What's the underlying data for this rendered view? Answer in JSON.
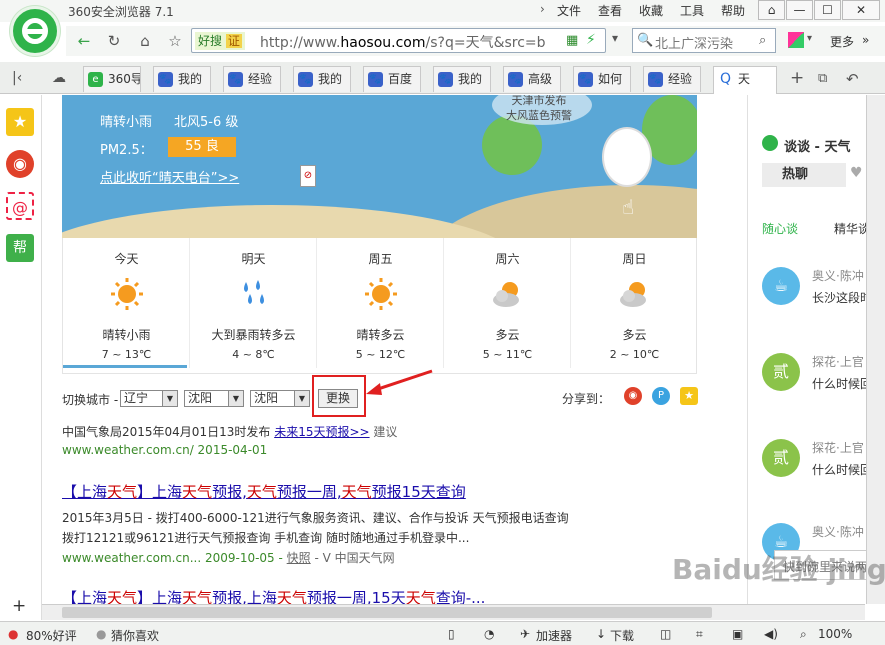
{
  "window": {
    "app_title": "360安全浏览器 7.1",
    "menu": [
      "文件",
      "查看",
      "收藏",
      "工具",
      "帮助"
    ],
    "controls": [
      "⌂",
      "—",
      "☐",
      "✕"
    ]
  },
  "address_bar": {
    "haosou_label": "好搜",
    "cert_label": "证",
    "url_prefix": "http://www.",
    "url_domain": "haosou.com",
    "url_rest": "/s?q=天气&src=b",
    "search_text": "北上广深污染",
    "more_label": "更多"
  },
  "tabs": [
    {
      "label": "360导"
    },
    {
      "label": "我的"
    },
    {
      "label": "经验"
    },
    {
      "label": "我的"
    },
    {
      "label": "百度"
    },
    {
      "label": "我的"
    },
    {
      "label": "高级"
    },
    {
      "label": "如何"
    },
    {
      "label": "经验"
    },
    {
      "label": "天"
    }
  ],
  "weather": {
    "condition_now": "晴转小雨",
    "wind": "北风5-6 级",
    "pm25_label": "PM2.5：",
    "pm25_value": "55 良",
    "radio_link": "点此收听“晴天电台”>>",
    "bubble_line1": "天津市发布",
    "bubble_line2": "大风蓝色预警",
    "days": [
      {
        "name": "今天",
        "icon": "sun-icon",
        "desc": "晴转小雨",
        "temp": "7 ~ 13℃"
      },
      {
        "name": "明天",
        "icon": "rain-icon",
        "desc": "大到暴雨转多云",
        "temp": "4 ~ 8℃"
      },
      {
        "name": "周五",
        "icon": "sun-icon",
        "desc": "晴转多云",
        "temp": "5 ~ 12℃"
      },
      {
        "name": "周六",
        "icon": "cloudy-icon",
        "desc": "多云",
        "temp": "5 ~ 11℃"
      },
      {
        "name": "周日",
        "icon": "cloudy-icon",
        "desc": "多云",
        "temp": "2 ~ 10℃"
      }
    ],
    "switch_city_label": "切换城市 -",
    "province": "辽宁",
    "city": "沈阳",
    "district": "沈阳",
    "change_button": "更换",
    "share_label": "分享到：",
    "source_prefix": "中国气象局2015年04月01日13时发布",
    "forecast_link": "未来15天预报>>",
    "suggest_link": "建议",
    "source_url": "www.weather.com.cn/ 2015-04-01"
  },
  "results": [
    {
      "title_parts": [
        "【上海",
        "天气",
        "】上海",
        "天气",
        "预报,",
        "天气",
        "预报一周,",
        "天气",
        "预报15天查询"
      ],
      "snippet1": "2015年3月5日 - 拨打400-6000-121进行气象服务资讯、建议、合作与投诉 天气预报电话查询",
      "snippet2": "拨打12121或96121进行天气预报查询 手机查询 随时随地通过手机登录中...",
      "url": "www.weather.com.cn... 2009-10-05 -",
      "snapshot": "快照",
      "verified": "- V 中国天气网"
    },
    {
      "title_parts": [
        "【上海",
        "天气",
        "】上海",
        "天气",
        "预报,上海",
        "天气",
        "预报一周,15天",
        "天气",
        "查询-..."
      ]
    }
  ],
  "right_panel": {
    "talk_label": "谈谈 - 天气",
    "hot_tab": "热聊",
    "tab_a": "随心谈",
    "tab_b": "精华谈",
    "posts": [
      {
        "user": "奥义·陈冲",
        "text": "长沙这段时"
      },
      {
        "user": "探花·上官",
        "text": "什么时候回"
      },
      {
        "user": "探花·上官",
        "text": "什么时候回"
      },
      {
        "user": "奥义·陈冲",
        "text": ""
      }
    ],
    "quick_comment": "快到碗里来说两"
  },
  "status": {
    "rating": "80%好评",
    "guess": "猜你喜欢",
    "accelerator": "加速器",
    "download": "下载",
    "zoom": "100%"
  },
  "watermark": "Baidu经验 jingyan.baidu.com",
  "colors": {
    "brand_green": "#2fb34a",
    "sky_blue": "#5aa7d6",
    "pm_badge": "#f5a623",
    "annotation_red": "#e02020"
  }
}
